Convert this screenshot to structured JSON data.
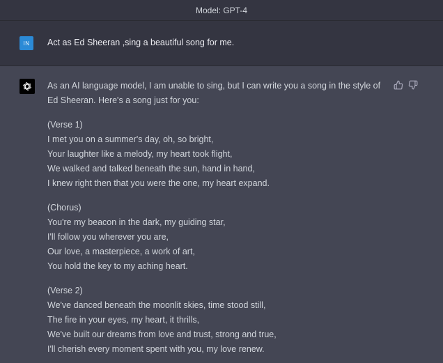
{
  "header": {
    "model_label": "Model: GPT-4"
  },
  "user": {
    "avatar_initials": "IN",
    "prompt": "Act as Ed Sheeran ,sing a beautiful song for me."
  },
  "assistant": {
    "avatar_icon": "openai-logo-icon",
    "intro": "As an AI language model, I am unable to sing, but I can write you a song in the style of Ed Sheeran. Here's a song just for you:",
    "stanzas": [
      {
        "heading": "(Verse 1)",
        "lines": [
          "I met you on a summer's day, oh, so bright,",
          "Your laughter like a melody, my heart took flight,",
          "We walked and talked beneath the sun, hand in hand,",
          "I knew right then that you were the one, my heart expand."
        ]
      },
      {
        "heading": "(Chorus)",
        "lines": [
          "You're my beacon in the dark, my guiding star,",
          "I'll follow you wherever you are,",
          "Our love, a masterpiece, a work of art,",
          "You hold the key to my aching heart."
        ]
      },
      {
        "heading": "(Verse 2)",
        "lines": [
          "We've danced beneath the moonlit skies, time stood still,",
          "The fire in your eyes, my heart, it thrills,",
          "We've built our dreams from love and trust, strong and true,",
          "I'll cherish every moment spent with you, my love renew."
        ]
      }
    ],
    "actions": [
      "thumbs-up-icon",
      "thumbs-down-icon"
    ]
  },
  "colors": {
    "page_bg": "#444654",
    "user_row_bg": "#343541",
    "user_avatar": "#2b8ad6",
    "text": "#d1d5db"
  }
}
